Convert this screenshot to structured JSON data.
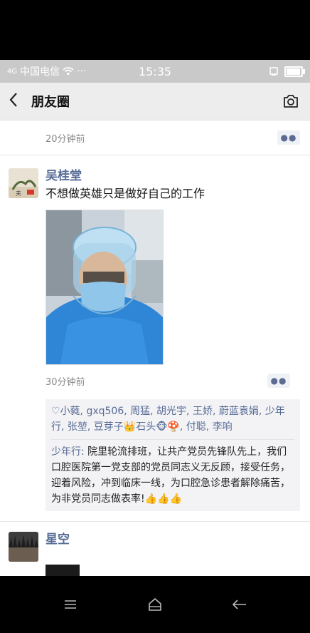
{
  "status": {
    "carrier": "中国电信",
    "signal": "4G",
    "more": "···",
    "time": "15:35",
    "battery_level": 0.85
  },
  "navbar": {
    "back_icon": "chevron-left-icon",
    "title": "朋友圈",
    "camera_icon": "camera-icon"
  },
  "feed": {
    "prev_time": "20分钟前",
    "post": {
      "name": "吴桂堂",
      "content": "不想做英雄只是做好自己的工作",
      "time": "30分钟前",
      "likes_heart": "♡",
      "likes": "小蕤, gxq506, 周猛, 胡光宇, 王娇, 蔚蓝袁娟, 少年行, 张堃, 豆芽子👑石头🐵🍄, 付聪, 李响",
      "comment_author": "少年行",
      "comment_sep": ": ",
      "comment_text": "院里轮流排班，让共产党员先锋队先上，我们口腔医院第一党支部的党员同志义无反顾，接受任务，迎着风险，冲到临床一线，为口腔急诊患者解除痛苦，为非党员同志做表率!👍👍👍"
    },
    "next_post": {
      "name": "星空"
    }
  },
  "bottom_nav": {
    "icons": [
      "menu-icon",
      "home-icon",
      "back-arrow-icon"
    ]
  },
  "colors": {
    "link": "#576b95",
    "status_bar": "#c9c9c9",
    "nav_bar": "#ededed"
  }
}
